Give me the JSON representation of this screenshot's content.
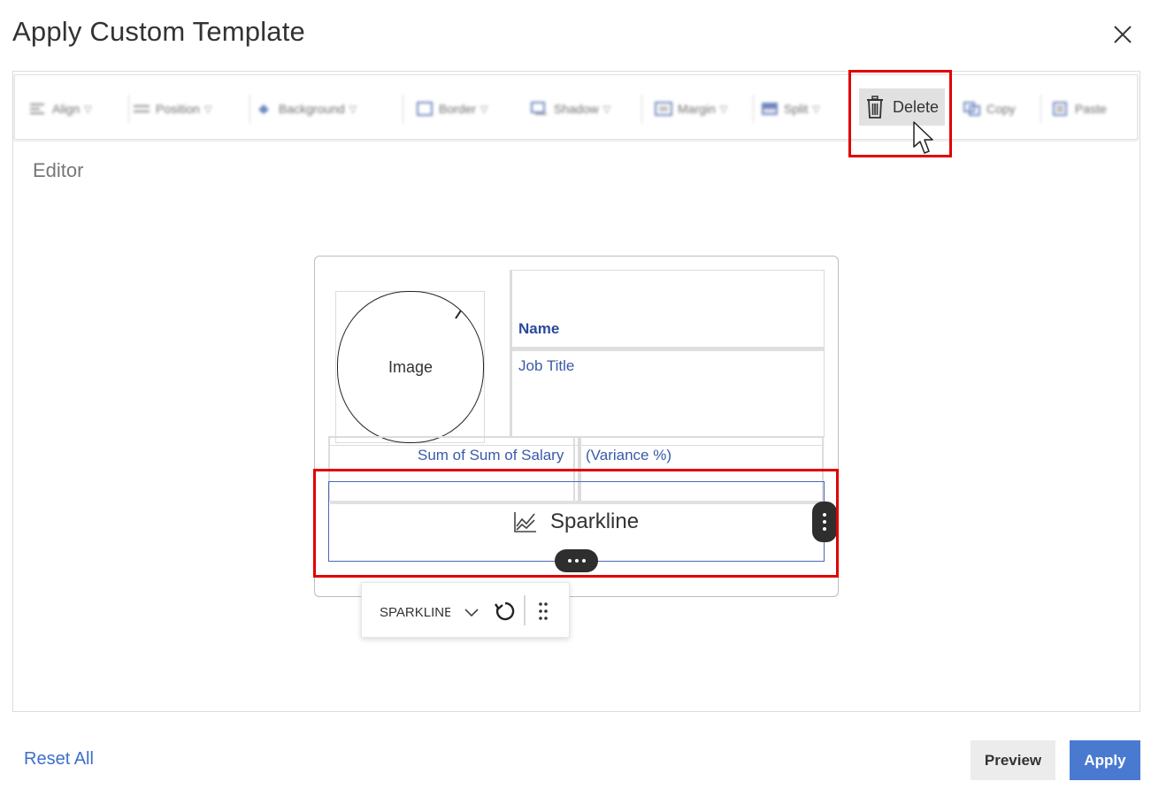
{
  "dialog": {
    "title": "Apply Custom Template"
  },
  "toolbar": {
    "items": [
      {
        "label": "Align",
        "icon": "align-icon"
      },
      {
        "label": "Position",
        "icon": "position-icon"
      },
      {
        "label": "Background",
        "icon": "background-icon"
      },
      {
        "label": "Border",
        "icon": "border-icon"
      },
      {
        "label": "Shadow",
        "icon": "shadow-icon"
      },
      {
        "label": "Margin",
        "icon": "margin-icon"
      },
      {
        "label": "Split",
        "icon": "split-icon"
      },
      {
        "label": "Copy",
        "icon": "copy-icon"
      },
      {
        "label": "Paste",
        "icon": "paste-icon"
      }
    ],
    "delete_label": "Delete"
  },
  "editor": {
    "label": "Editor"
  },
  "template": {
    "image_label": "Image",
    "name_label": "Name",
    "job_title_label": "Job Title",
    "metric_label": "Sum of Sum of Salary",
    "variance_label": "(Variance %)",
    "sparkline_label": "Sparkline"
  },
  "sparkline_toolbar": {
    "selected_type": "SPARKLINE"
  },
  "footer": {
    "reset_label": "Reset All",
    "preview_label": "Preview",
    "apply_label": "Apply"
  },
  "colors": {
    "accent": "#4a7ad0",
    "highlight": "#e00000",
    "link": "#3c6fcc",
    "field_text": "#3a5aa8"
  }
}
